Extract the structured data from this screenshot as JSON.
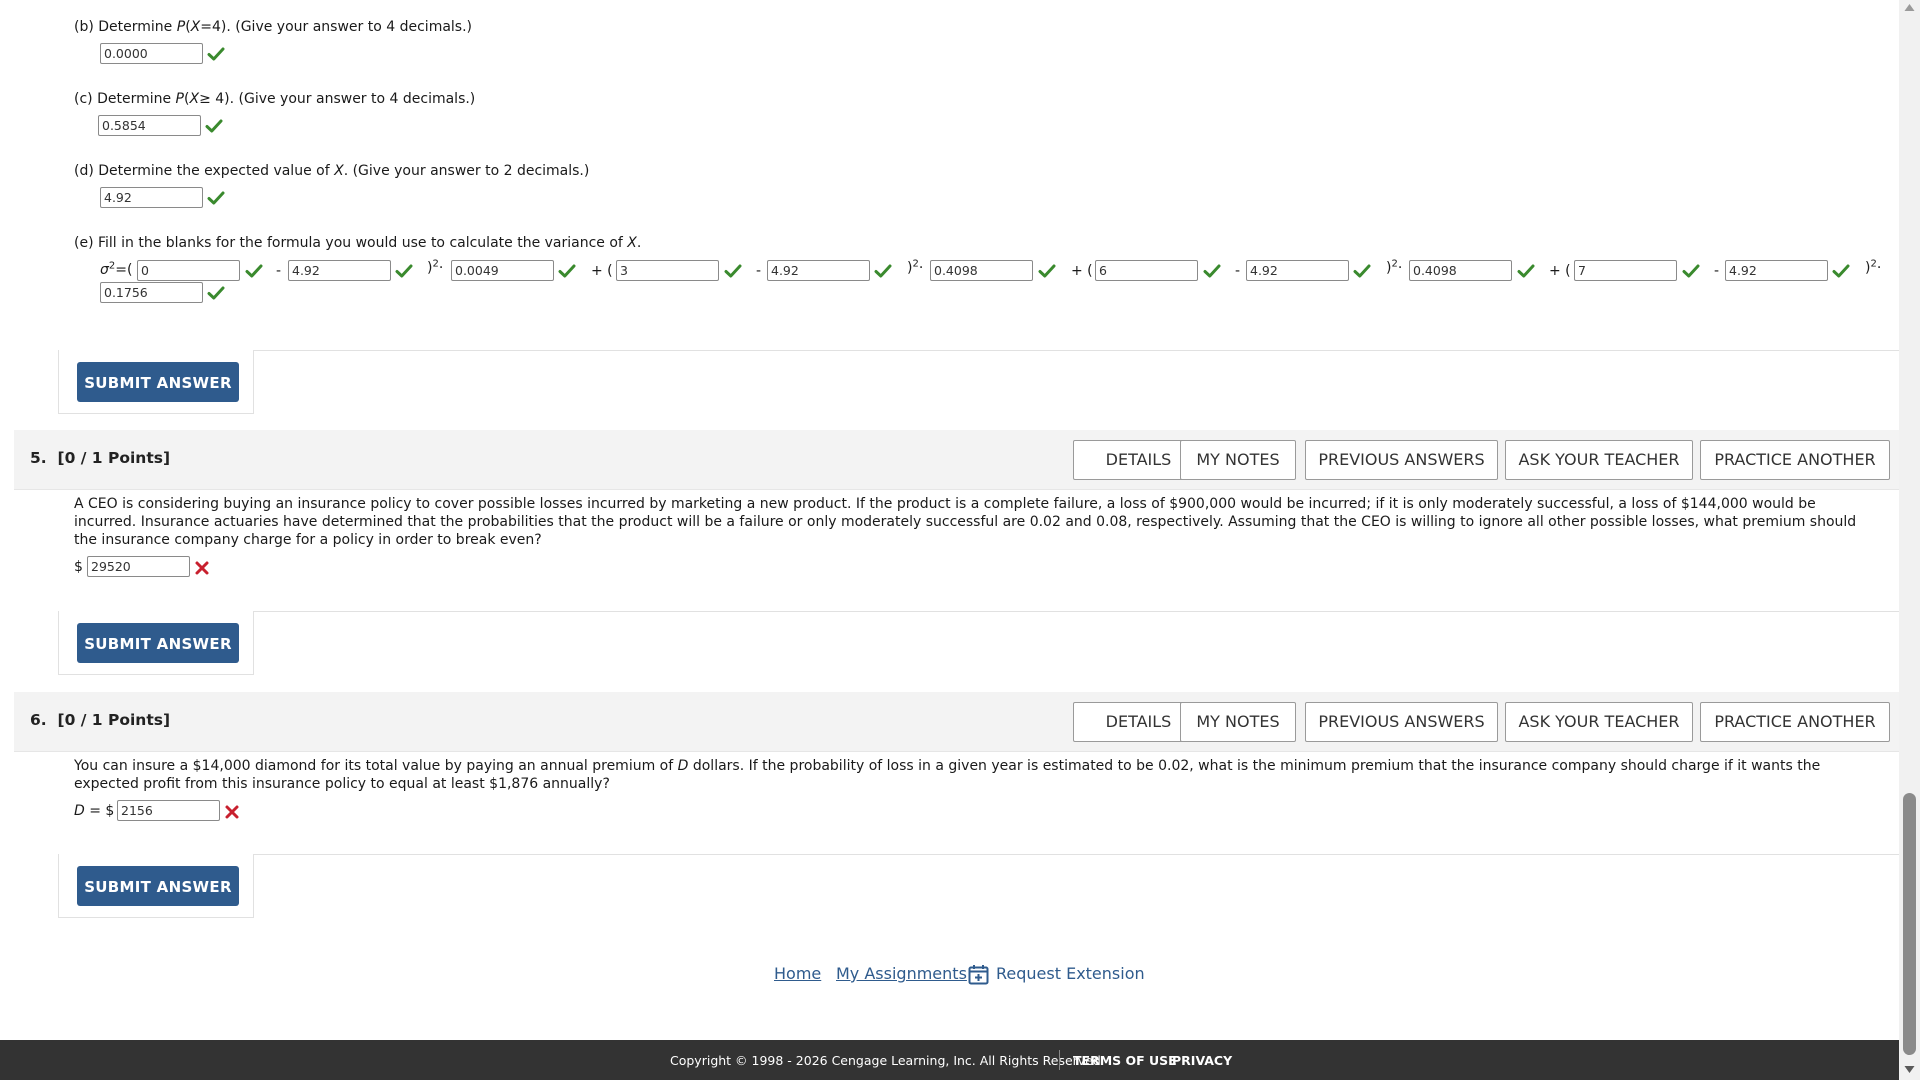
{
  "part_b": {
    "text_pre": "(b) Determine ",
    "fn": "P",
    "text_mid": "(",
    "var": "X",
    "text_rest": "=4). (Give your answer to 4 decimals.)",
    "answer": "0.0000"
  },
  "part_c": {
    "text_pre": "(c) Determine ",
    "fn": "P",
    "text_mid": "(",
    "var": "X",
    "text_rest": "≥ 4). (Give your answer to 4 decimals.)",
    "answer": "0.5854"
  },
  "part_d": {
    "text_pre": "(d) Determine the expected value of ",
    "var": "X",
    "text_rest": ". (Give your answer to 2 decimals.)",
    "answer": "4.92"
  },
  "part_e": {
    "text_pre": "(e) Fill in the blanks for the formula you would use to calculate the variance of ",
    "var": "X",
    "text_rest": ".",
    "sigma_label": "σ",
    "eq_open": "=(",
    "minus": "-",
    "close_sq": ")",
    "sq": "2",
    "dot": "·",
    "plus_open": "+ (",
    "values": [
      "0",
      "4.92",
      "0.0049",
      "3",
      "4.92",
      "0.4098",
      "6",
      "4.92",
      "0.4098",
      "7",
      "4.92",
      "0.1756"
    ]
  },
  "submit_label": "SUBMIT ANSWER",
  "q5": {
    "number": "5.",
    "points": "[0 / 1 Points]",
    "buttons": [
      "DETAILS",
      "MY NOTES",
      "PREVIOUS ANSWERS",
      "ASK YOUR TEACHER",
      "PRACTICE ANOTHER"
    ],
    "text": "A CEO is considering buying an insurance policy to cover possible losses incurred by marketing a new product. If the product is a complete failure, a loss of $900,000 would be incurred; if it is only moderately successful, a loss of $144,000 would be incurred. Insurance actuaries have determined that the probabilities that the product will be a failure or only moderately successful are 0.02 and 0.08, respectively. Assuming that the CEO is willing to ignore all other possible losses, what premium should the insurance company charge for a policy in order to break even?",
    "prefix": "$",
    "answer": "29520"
  },
  "q6": {
    "number": "6.",
    "points": "[0 / 1 Points]",
    "buttons": [
      "DETAILS",
      "MY NOTES",
      "PREVIOUS ANSWERS",
      "ASK YOUR TEACHER",
      "PRACTICE ANOTHER"
    ],
    "text_pre": "You can insure a $14,000 diamond for its total value by paying an annual premium of ",
    "var": "D",
    "text_rest": " dollars. If the probability of loss in a given year is estimated to be 0.02, what is the minimum premium that the insurance company should charge if it wants the expected profit from this insurance policy to equal at least $1,876 annually?",
    "prefix_var": "D",
    "prefix_rest": " = $",
    "answer": "2156"
  },
  "links": {
    "home": "Home",
    "assignments": "My Assignments",
    "extension": "Request Extension"
  },
  "footer": {
    "copyright": "Copyright © 1998 - 2026 Cengage Learning, Inc. All Rights Reserved",
    "terms": "TERMS OF USE",
    "privacy": "PRIVACY"
  },
  "colors": {
    "correct": "#3a8a2e",
    "incorrect": "#c8202e",
    "button": "#2f5b8d",
    "footer": "#333333"
  }
}
